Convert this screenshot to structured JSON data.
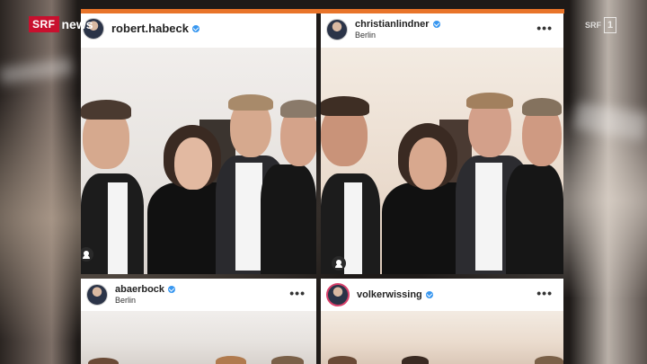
{
  "broadcaster": {
    "brand": "SRF",
    "brand_suffix": "news",
    "channel_prefix": "SRF",
    "channel_number": "1"
  },
  "posts": [
    {
      "username": "robert.habeck",
      "location": "",
      "verified": true
    },
    {
      "username": "christianlindner",
      "location": "Berlin",
      "verified": true
    },
    {
      "username": "abaerbock",
      "location": "Berlin",
      "verified": true
    },
    {
      "username": "volkerwissing",
      "location": "",
      "verified": true
    }
  ],
  "colors": {
    "accent_bar": "#e8742a",
    "srf_red": "#c8102e",
    "verified_blue": "#3897f0"
  },
  "icons": {
    "verified": "verified-badge-icon",
    "more": "more-options-icon",
    "tag": "user-tag-icon"
  }
}
